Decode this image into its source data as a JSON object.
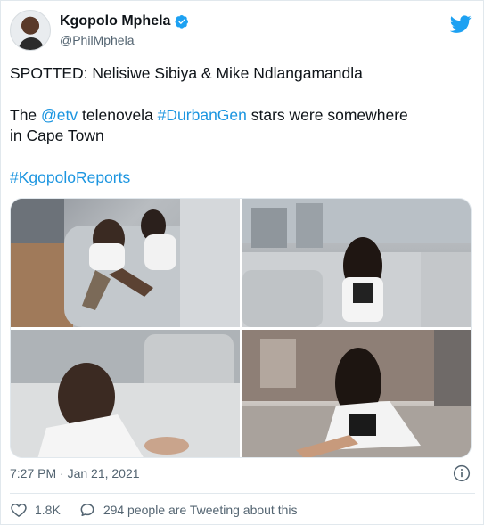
{
  "tweet": {
    "author_name": "Kgopolo Mphela",
    "handle": "@PhilMphela",
    "line1": "SPOTTED: Nelisiwe Sibiya & Mike Ndlangamandla",
    "line2_prefix": "The ",
    "mention": "@etv",
    "line2_middle": " telenovela ",
    "hashtag1": "#DurbanGen",
    "line2_suffix": " stars were somewhere",
    "line2_cont": "in Cape Town",
    "hashtag2": "#KgopoloReports",
    "timestamp": "7:27 PM · Jan 21, 2021",
    "likes": "1.8K",
    "replies_text": "294 people are Tweeting about this"
  },
  "colors": {
    "link": "#1b95e0",
    "twitter_blue": "#1da1f2",
    "muted": "#536471"
  },
  "icons": {
    "verified": "verified-badge-icon",
    "logo": "twitter-bird-icon",
    "info": "info-icon",
    "like": "heart-icon",
    "reply": "speech-bubble-icon"
  }
}
